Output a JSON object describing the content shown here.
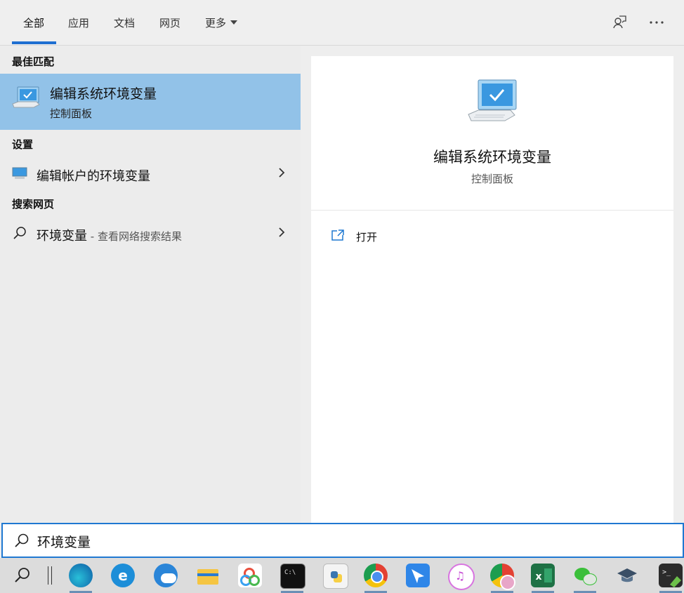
{
  "tabs": [
    {
      "label": "全部"
    },
    {
      "label": "应用"
    },
    {
      "label": "文档"
    },
    {
      "label": "网页"
    },
    {
      "label": "更多"
    }
  ],
  "top_icons": [
    "feedback-icon",
    "more-icon"
  ],
  "left": {
    "best_match_heading": "最佳匹配",
    "best_match": {
      "title": "编辑系统环境变量",
      "subtitle": "控制面板"
    },
    "settings_heading": "设置",
    "settings_item": "编辑帐户的环境变量",
    "web_heading": "搜索网页",
    "web_item": {
      "query": "环境变量",
      "suffix": " - 查看网络搜索结果"
    }
  },
  "right": {
    "title": "编辑系统环境变量",
    "subtitle": "控制面板",
    "actions": [
      {
        "label": "打开",
        "icon": "open-external-icon"
      }
    ]
  },
  "search": {
    "value": "环境变量"
  },
  "taskbar_icons": [
    "search-icon",
    "edge-icon",
    "ie-icon",
    "cortana-icon",
    "file-explorer-icon",
    "baidu-netdisk-icon",
    "terminal-icon",
    "python-file-icon",
    "chrome-icon",
    "feishu-icon",
    "itunes-icon",
    "chrome-profile-icon",
    "excel-icon",
    "wechat-icon",
    "graduation-icon",
    "dev-console-icon"
  ],
  "colors": {
    "accent": "#1f78d1",
    "selected": "#92c2e8"
  }
}
